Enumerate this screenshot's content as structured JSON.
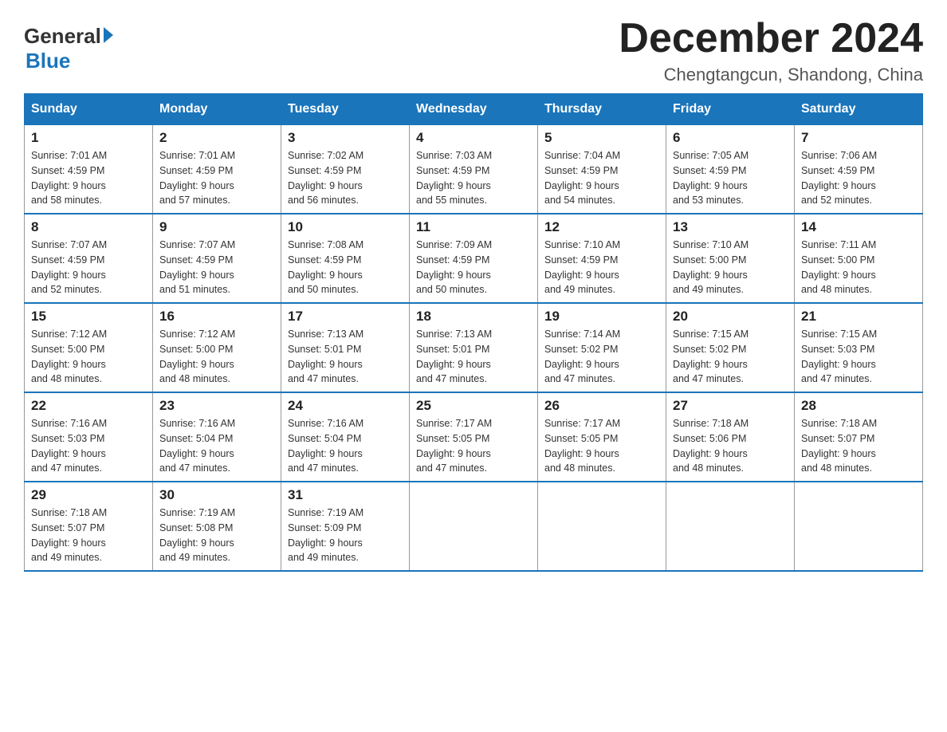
{
  "header": {
    "logo_general": "General",
    "logo_blue": "Blue",
    "month_title": "December 2024",
    "location": "Chengtangcun, Shandong, China"
  },
  "weekdays": [
    "Sunday",
    "Monday",
    "Tuesday",
    "Wednesday",
    "Thursday",
    "Friday",
    "Saturday"
  ],
  "weeks": [
    [
      {
        "day": "1",
        "sunrise": "7:01 AM",
        "sunset": "4:59 PM",
        "daylight": "9 hours and 58 minutes."
      },
      {
        "day": "2",
        "sunrise": "7:01 AM",
        "sunset": "4:59 PM",
        "daylight": "9 hours and 57 minutes."
      },
      {
        "day": "3",
        "sunrise": "7:02 AM",
        "sunset": "4:59 PM",
        "daylight": "9 hours and 56 minutes."
      },
      {
        "day": "4",
        "sunrise": "7:03 AM",
        "sunset": "4:59 PM",
        "daylight": "9 hours and 55 minutes."
      },
      {
        "day": "5",
        "sunrise": "7:04 AM",
        "sunset": "4:59 PM",
        "daylight": "9 hours and 54 minutes."
      },
      {
        "day": "6",
        "sunrise": "7:05 AM",
        "sunset": "4:59 PM",
        "daylight": "9 hours and 53 minutes."
      },
      {
        "day": "7",
        "sunrise": "7:06 AM",
        "sunset": "4:59 PM",
        "daylight": "9 hours and 52 minutes."
      }
    ],
    [
      {
        "day": "8",
        "sunrise": "7:07 AM",
        "sunset": "4:59 PM",
        "daylight": "9 hours and 52 minutes."
      },
      {
        "day": "9",
        "sunrise": "7:07 AM",
        "sunset": "4:59 PM",
        "daylight": "9 hours and 51 minutes."
      },
      {
        "day": "10",
        "sunrise": "7:08 AM",
        "sunset": "4:59 PM",
        "daylight": "9 hours and 50 minutes."
      },
      {
        "day": "11",
        "sunrise": "7:09 AM",
        "sunset": "4:59 PM",
        "daylight": "9 hours and 50 minutes."
      },
      {
        "day": "12",
        "sunrise": "7:10 AM",
        "sunset": "4:59 PM",
        "daylight": "9 hours and 49 minutes."
      },
      {
        "day": "13",
        "sunrise": "7:10 AM",
        "sunset": "5:00 PM",
        "daylight": "9 hours and 49 minutes."
      },
      {
        "day": "14",
        "sunrise": "7:11 AM",
        "sunset": "5:00 PM",
        "daylight": "9 hours and 48 minutes."
      }
    ],
    [
      {
        "day": "15",
        "sunrise": "7:12 AM",
        "sunset": "5:00 PM",
        "daylight": "9 hours and 48 minutes."
      },
      {
        "day": "16",
        "sunrise": "7:12 AM",
        "sunset": "5:00 PM",
        "daylight": "9 hours and 48 minutes."
      },
      {
        "day": "17",
        "sunrise": "7:13 AM",
        "sunset": "5:01 PM",
        "daylight": "9 hours and 47 minutes."
      },
      {
        "day": "18",
        "sunrise": "7:13 AM",
        "sunset": "5:01 PM",
        "daylight": "9 hours and 47 minutes."
      },
      {
        "day": "19",
        "sunrise": "7:14 AM",
        "sunset": "5:02 PM",
        "daylight": "9 hours and 47 minutes."
      },
      {
        "day": "20",
        "sunrise": "7:15 AM",
        "sunset": "5:02 PM",
        "daylight": "9 hours and 47 minutes."
      },
      {
        "day": "21",
        "sunrise": "7:15 AM",
        "sunset": "5:03 PM",
        "daylight": "9 hours and 47 minutes."
      }
    ],
    [
      {
        "day": "22",
        "sunrise": "7:16 AM",
        "sunset": "5:03 PM",
        "daylight": "9 hours and 47 minutes."
      },
      {
        "day": "23",
        "sunrise": "7:16 AM",
        "sunset": "5:04 PM",
        "daylight": "9 hours and 47 minutes."
      },
      {
        "day": "24",
        "sunrise": "7:16 AM",
        "sunset": "5:04 PM",
        "daylight": "9 hours and 47 minutes."
      },
      {
        "day": "25",
        "sunrise": "7:17 AM",
        "sunset": "5:05 PM",
        "daylight": "9 hours and 47 minutes."
      },
      {
        "day": "26",
        "sunrise": "7:17 AM",
        "sunset": "5:05 PM",
        "daylight": "9 hours and 48 minutes."
      },
      {
        "day": "27",
        "sunrise": "7:18 AM",
        "sunset": "5:06 PM",
        "daylight": "9 hours and 48 minutes."
      },
      {
        "day": "28",
        "sunrise": "7:18 AM",
        "sunset": "5:07 PM",
        "daylight": "9 hours and 48 minutes."
      }
    ],
    [
      {
        "day": "29",
        "sunrise": "7:18 AM",
        "sunset": "5:07 PM",
        "daylight": "9 hours and 49 minutes."
      },
      {
        "day": "30",
        "sunrise": "7:19 AM",
        "sunset": "5:08 PM",
        "daylight": "9 hours and 49 minutes."
      },
      {
        "day": "31",
        "sunrise": "7:19 AM",
        "sunset": "5:09 PM",
        "daylight": "9 hours and 49 minutes."
      },
      null,
      null,
      null,
      null
    ]
  ],
  "labels": {
    "sunrise_prefix": "Sunrise: ",
    "sunset_prefix": "Sunset: ",
    "daylight_prefix": "Daylight: "
  }
}
